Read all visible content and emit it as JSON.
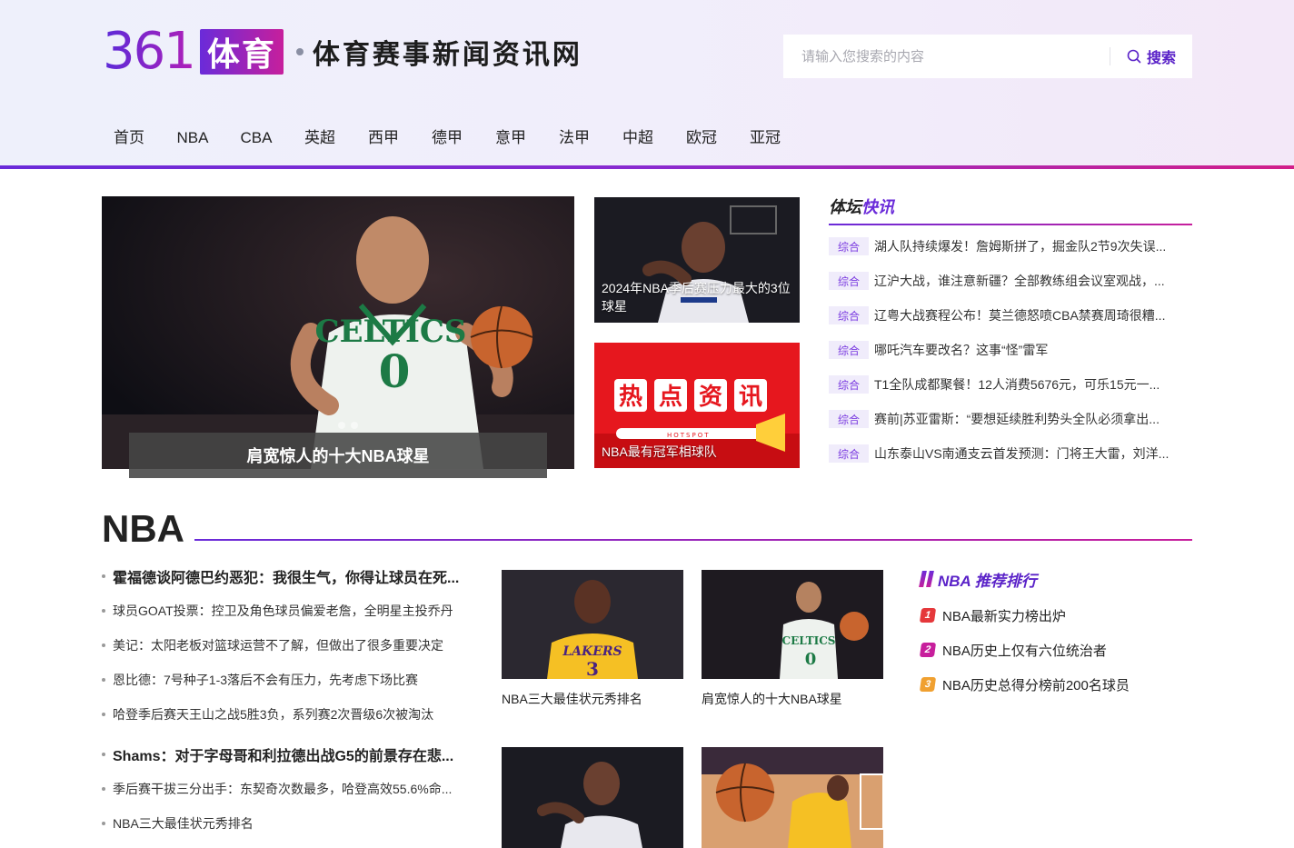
{
  "header": {
    "logo_number": "361",
    "logo_box": "体育",
    "slogan": "体育赛事新闻资讯网",
    "search_placeholder": "请输入您搜索的内容",
    "search_button": "搜索"
  },
  "nav": [
    "首页",
    "NBA",
    "CBA",
    "英超",
    "西甲",
    "德甲",
    "意甲",
    "法甲",
    "中超",
    "欧冠",
    "亚冠"
  ],
  "hero": {
    "caption": "肩宽惊人的十大NBA球星",
    "jersey_text": "CELTICS",
    "jersey_number": "0"
  },
  "cards": [
    {
      "caption": "2024年NBA季后赛压力最大的3位球星"
    },
    {
      "caption": "NBA最有冠军相球队",
      "banner_chars": [
        "热",
        "点",
        "资",
        "讯"
      ],
      "banner_sub": "HOTSPOT"
    }
  ],
  "flash": {
    "title_plain": "体坛",
    "title_accent": "快讯",
    "items": [
      {
        "tag": "综合",
        "text": "湖人队持续爆发！詹姆斯拼了，掘金队2节9次失误..."
      },
      {
        "tag": "综合",
        "text": "辽沪大战，谁注意新疆？全部教练组会议室观战，..."
      },
      {
        "tag": "综合",
        "text": "辽粤大战赛程公布！莫兰德怒喷CBA禁赛周琦很糟..."
      },
      {
        "tag": "综合",
        "text": "哪吒汽车要改名？这事“怪”雷军"
      },
      {
        "tag": "综合",
        "text": "T1全队成都聚餐！12人消费5676元，可乐15元一..."
      },
      {
        "tag": "综合",
        "text": "赛前|苏亚雷斯：“要想延续胜利势头全队必须拿出..."
      },
      {
        "tag": "综合",
        "text": "山东泰山VS南通支云首发预测：门将王大雷，刘洋..."
      }
    ]
  },
  "nba": {
    "section_title": "NBA",
    "news_group_1": [
      {
        "text": "霍福德谈阿德巴约恶犯：我很生气，你得让球员在死...",
        "lead": true
      },
      {
        "text": "球员GOAT投票：控卫及角色球员偏爱老詹，全明星主投乔丹",
        "lead": false
      },
      {
        "text": "美记：太阳老板对篮球运营不了解，但做出了很多重要决定",
        "lead": false
      },
      {
        "text": "恩比德：7号种子1-3落后不会有压力，先考虑下场比赛",
        "lead": false
      },
      {
        "text": "哈登季后赛天王山之战5胜3负，系列赛2次晋级6次被淘汰",
        "lead": false
      }
    ],
    "news_group_2": [
      {
        "text": "Shams：对于字母哥和利拉德出战G5的前景存在悲...",
        "lead": true
      },
      {
        "text": "季后赛干拔三分出手：东契奇次数最多，哈登高效55.6%命...",
        "lead": false
      },
      {
        "text": "NBA三大最佳状元秀排名",
        "lead": false
      }
    ],
    "thumbs": [
      {
        "caption": "NBA三大最佳状元秀排名",
        "jersey_text": "LAKERS",
        "jersey_number": "3"
      },
      {
        "caption": "肩宽惊人的十大NBA球星",
        "jersey_text": "CELTICS",
        "jersey_number": "0"
      }
    ],
    "ranking": {
      "title": "NBA 推荐排行",
      "items": [
        {
          "num": "1",
          "text": "NBA最新实力榜出炉",
          "color": "#e5383b"
        },
        {
          "num": "2",
          "text": "NBA历史上仅有六位统治者",
          "color": "#c71f9c"
        },
        {
          "num": "3",
          "text": "NBA历史总得分榜前200名球员",
          "color": "#f0a030"
        }
      ]
    }
  }
}
